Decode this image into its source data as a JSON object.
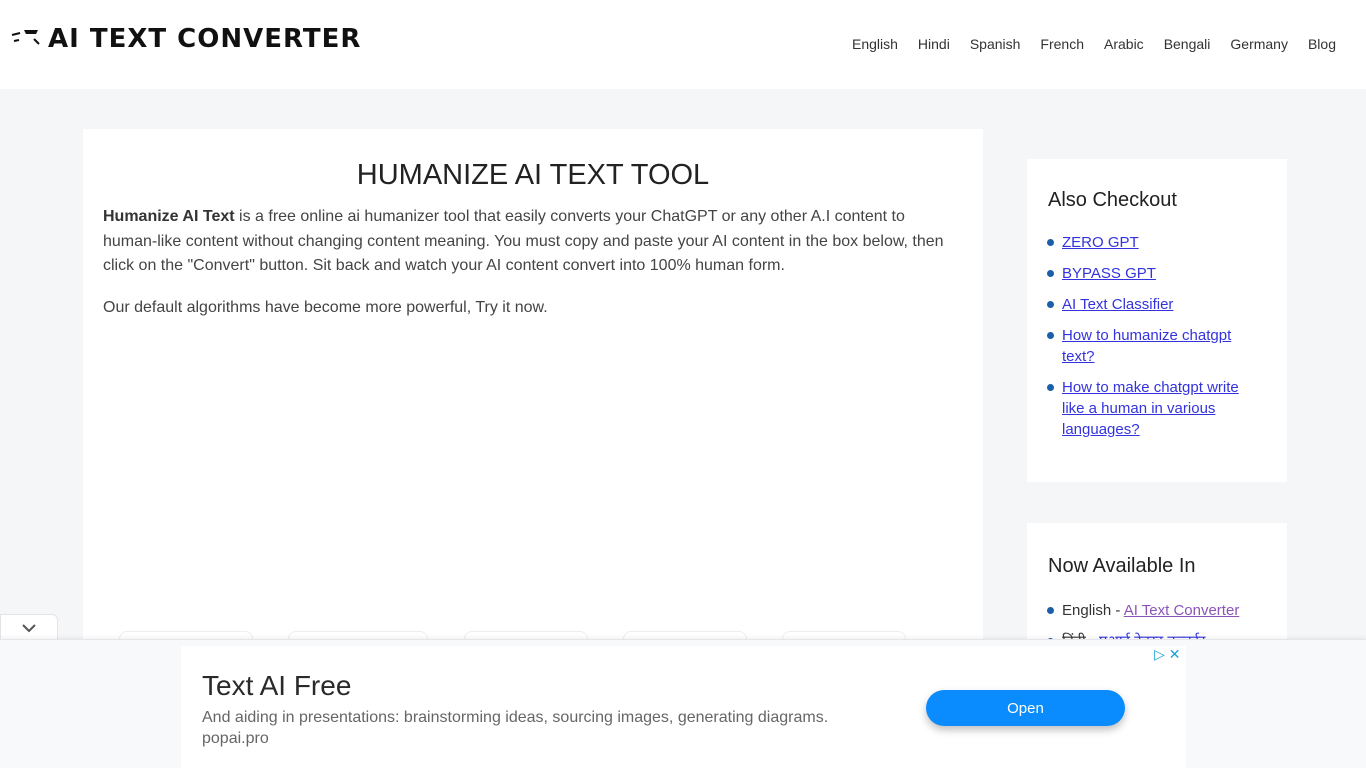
{
  "header": {
    "logo_text": "AI TEXT CONVERTER",
    "nav": [
      "English",
      "Hindi",
      "Spanish",
      "French",
      "Arabic",
      "Bengali",
      "Germany",
      "Blog"
    ]
  },
  "main": {
    "title": "HUMANIZE AI TEXT TOOL",
    "intro_bold": "Humanize AI Text",
    "intro_rest": " is a free online ai humanizer tool that easily converts your ChatGPT or any other A.I content to human-like content without changing content meaning. You must copy and paste your AI content in the box below, then click on the \"Convert\" button. Sit back and watch your AI content convert into 100% human form.",
    "intro2": "Our default algorithms have become more powerful, Try it now."
  },
  "sidebar": {
    "also_checkout": {
      "heading": "Also Checkout",
      "links": [
        "ZERO GPT",
        "BYPASS GPT",
        "AI Text Classifier",
        "How to humanize chatgpt text?",
        "How to make chatgpt write like a human in various languages?"
      ]
    },
    "now_available": {
      "heading": "Now Available In",
      "items": [
        {
          "lang": "English - ",
          "link": "AI Text Converter"
        },
        {
          "lang": "हिंदी - ",
          "link": "एआई टेक्स्ट कन्वर्टर"
        }
      ]
    }
  },
  "ad": {
    "title": "Text AI Free",
    "description": "And aiding in presentations: brainstorming ideas, sourcing images, generating diagrams.",
    "domain": "popai.pro",
    "button_label": "Open",
    "adchoices_icon": "▷",
    "close_icon": "✕"
  },
  "collapse_icon": "⌄"
}
